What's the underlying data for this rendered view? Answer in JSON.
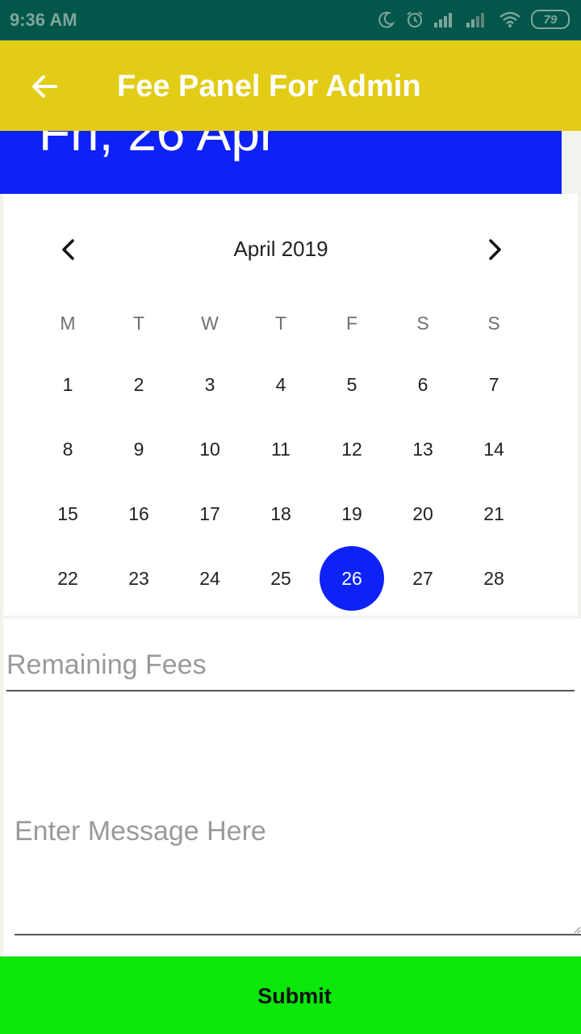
{
  "status_bar": {
    "time": "9:36 AM",
    "battery": "79",
    "icons": [
      "moon-icon",
      "alarm-icon",
      "signal-icon",
      "signal-icon",
      "wifi-icon",
      "battery-icon"
    ]
  },
  "toolbar": {
    "title": "Fee Panel For Admin",
    "back_icon": "arrow-back-icon",
    "background": "#e2cc16"
  },
  "date_header": {
    "text": "Fri, 26 Apr",
    "background": "#0e22f8"
  },
  "calendar": {
    "month_label": "April 2019",
    "prev_icon": "chevron-left-icon",
    "next_icon": "chevron-right-icon",
    "weekdays": [
      "M",
      "T",
      "W",
      "T",
      "F",
      "S",
      "S"
    ],
    "weeks": [
      [
        "1",
        "2",
        "3",
        "4",
        "5",
        "6",
        "7"
      ],
      [
        "8",
        "9",
        "10",
        "11",
        "12",
        "13",
        "14"
      ],
      [
        "15",
        "16",
        "17",
        "18",
        "19",
        "20",
        "21"
      ],
      [
        "22",
        "23",
        "24",
        "25",
        "26",
        "27",
        "28"
      ]
    ],
    "selected_day": "26",
    "selected_color": "#0e22f8"
  },
  "form": {
    "fees_placeholder": "Remaining Fees",
    "fees_value": "",
    "message_placeholder": "Enter Message Here",
    "message_value": ""
  },
  "submit": {
    "label": "Submit",
    "background": "#0be60b"
  }
}
